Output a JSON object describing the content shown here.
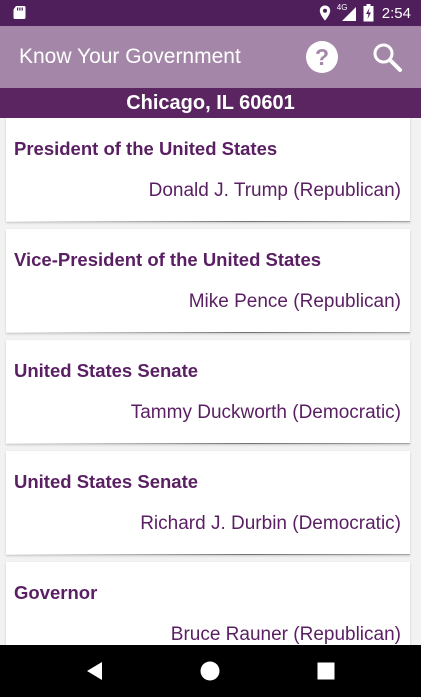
{
  "status_bar": {
    "time": "2:54",
    "network": "4G",
    "icons": [
      "sd-card-icon",
      "location-icon",
      "signal-icon",
      "battery-icon"
    ]
  },
  "app_bar": {
    "title": "Know Your Government",
    "actions": [
      "help-icon",
      "search-icon"
    ]
  },
  "location": "Chicago, IL 60601",
  "officials": [
    {
      "office": "President of the United States",
      "name": "Donald J. Trump (Republican)"
    },
    {
      "office": "Vice-President of the United States",
      "name": "Mike Pence (Republican)"
    },
    {
      "office": "United States Senate",
      "name": "Tammy Duckworth (Democratic)"
    },
    {
      "office": "United States Senate",
      "name": "Richard J. Durbin (Democratic)"
    },
    {
      "office": "Governor",
      "name": "Bruce Rauner (Republican)"
    }
  ],
  "colors": {
    "status_bar": "#4e1f5b",
    "app_bar": "#a487a8",
    "location_bar": "#5b2562",
    "text_accent": "#5a1f63"
  },
  "nav_bar": {
    "buttons": [
      "back-icon",
      "home-icon",
      "recent-apps-icon"
    ]
  }
}
